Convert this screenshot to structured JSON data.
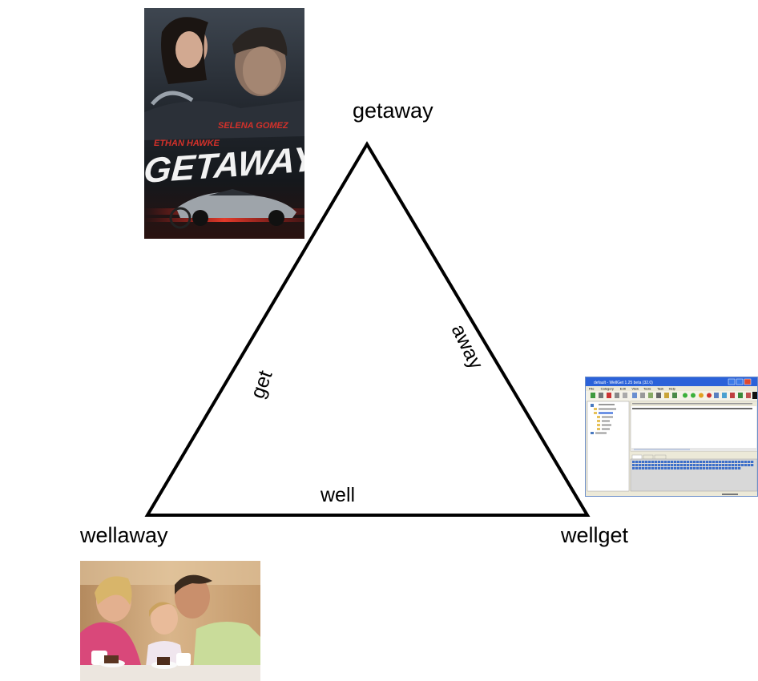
{
  "nodes": {
    "top": {
      "label": "getaway"
    },
    "left": {
      "label": "wellaway"
    },
    "right": {
      "label": "wellget"
    }
  },
  "edges": {
    "left": {
      "label": "get"
    },
    "right": {
      "label": "away"
    },
    "bottom": {
      "label": "well"
    }
  },
  "images": {
    "poster": {
      "actor1": "ETHAN HAWKE",
      "actor2": "SELENA GOMEZ",
      "title": "GETAWAY"
    },
    "screenshot": {
      "window_title": "default - WellGet 1.25 beta (32.0)",
      "menu_items": [
        "File",
        "Category",
        "Edit",
        "View",
        "Tools",
        "Task",
        "Help"
      ]
    }
  }
}
